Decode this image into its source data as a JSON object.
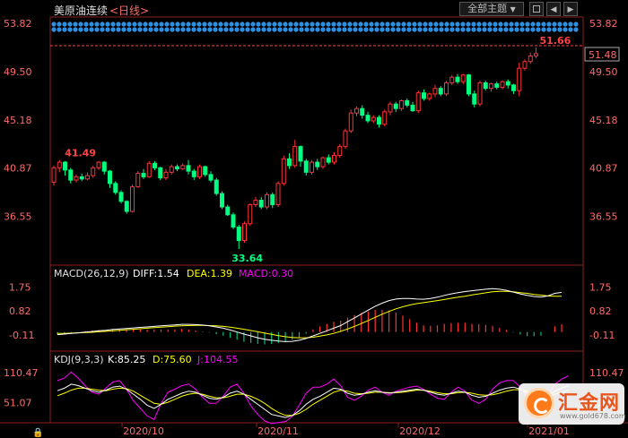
{
  "header": {
    "title": "美原油连续",
    "period": "<日线>",
    "theme_button": "全部主题",
    "theme_arrow": "▼"
  },
  "price_panel": {
    "last_price": "51.48",
    "annotations": {
      "high": "41.49",
      "low": "33.64",
      "peak": "51.66"
    }
  },
  "macd": {
    "label": "MACD(26,12,9)",
    "diff_label": "DIFF:1.54",
    "dea_label": "DEA:1.39",
    "macd_label": "MACD:0.30",
    "colors": {
      "diff": "#ffffff",
      "dea": "#ffff00",
      "macd": "#ff00ff",
      "up": "#ff3232",
      "down": "#00c080"
    }
  },
  "kdj": {
    "label": "KDJ(9,3,3)",
    "k_label": "K:85.25",
    "d_label": "D:75.60",
    "j_label": "J:104.55"
  },
  "watermark": {
    "name": "汇金网",
    "url": "www.gold678.com"
  },
  "chart_data": [
    {
      "type": "candlestick",
      "title": "美原油连续 <日线>",
      "ylim": [
        33.0,
        53.82
      ],
      "y_ticks": [
        "53.82",
        "49.50",
        "45.18",
        "40.87",
        "36.55"
      ],
      "x_ticks": [
        "2020/10",
        "2020/11",
        "2020/12",
        "2021/01"
      ],
      "colors": {
        "up": "#ff3232",
        "down": "#00ff80"
      },
      "candles": [
        [
          39.6,
          40.9,
          39.3,
          41.1
        ],
        [
          40.9,
          41.4,
          40.5,
          41.6
        ],
        [
          41.4,
          40.7,
          40.2,
          41.5
        ],
        [
          40.7,
          39.8,
          39.5,
          40.9
        ],
        [
          39.8,
          40.1,
          39.6,
          40.3
        ],
        [
          40.1,
          39.9,
          39.7,
          40.4
        ],
        [
          39.9,
          40.2,
          39.8,
          40.5
        ],
        [
          40.2,
          40.9,
          40.0,
          41.1
        ],
        [
          40.9,
          41.4,
          40.7,
          41.5
        ],
        [
          41.4,
          40.6,
          40.3,
          41.5
        ],
        [
          40.6,
          39.5,
          39.1,
          40.7
        ],
        [
          39.5,
          38.7,
          38.5,
          39.7
        ],
        [
          38.7,
          37.9,
          37.7,
          38.9
        ],
        [
          37.9,
          37.0,
          36.8,
          38.0
        ],
        [
          37.0,
          39.2,
          36.9,
          39.4
        ],
        [
          39.2,
          40.4,
          39.1,
          40.6
        ],
        [
          40.4,
          40.1,
          39.9,
          40.8
        ],
        [
          40.1,
          41.3,
          40.0,
          41.5
        ],
        [
          41.3,
          40.9,
          40.7,
          41.5
        ],
        [
          40.9,
          40.0,
          39.8,
          41.0
        ],
        [
          40.0,
          40.5,
          39.8,
          40.8
        ],
        [
          40.5,
          41.0,
          40.3,
          41.2
        ],
        [
          41.0,
          40.8,
          40.6,
          41.2
        ],
        [
          40.8,
          41.1,
          40.7,
          41.3
        ],
        [
          41.1,
          40.6,
          40.3,
          41.6
        ],
        [
          40.6,
          40.1,
          39.8,
          40.8
        ],
        [
          40.1,
          41.0,
          39.9,
          41.2
        ],
        [
          41.0,
          40.3,
          40.1,
          41.1
        ],
        [
          40.3,
          39.8,
          39.6,
          40.6
        ],
        [
          39.8,
          38.6,
          38.4,
          40.0
        ],
        [
          38.6,
          37.4,
          37.2,
          38.8
        ],
        [
          37.4,
          36.7,
          36.6,
          37.6
        ],
        [
          36.7,
          35.6,
          35.4,
          36.9
        ],
        [
          35.6,
          34.4,
          33.64,
          35.8
        ],
        [
          34.4,
          35.9,
          34.2,
          36.1
        ],
        [
          35.9,
          37.6,
          35.7,
          37.7
        ],
        [
          37.6,
          38.0,
          37.4,
          38.3
        ],
        [
          38.0,
          37.4,
          37.2,
          38.3
        ],
        [
          37.4,
          38.5,
          37.2,
          38.7
        ],
        [
          38.5,
          37.6,
          37.3,
          38.7
        ],
        [
          37.6,
          39.5,
          37.4,
          39.7
        ],
        [
          39.5,
          41.7,
          39.3,
          42.0
        ],
        [
          41.7,
          41.1,
          40.8,
          42.2
        ],
        [
          41.1,
          42.8,
          40.9,
          43.4
        ],
        [
          42.8,
          41.5,
          41.0,
          42.9
        ],
        [
          41.5,
          40.5,
          40.2,
          41.7
        ],
        [
          40.5,
          41.4,
          40.3,
          41.6
        ],
        [
          41.4,
          41.0,
          40.7,
          41.7
        ],
        [
          41.0,
          41.8,
          40.8,
          41.9
        ],
        [
          41.8,
          41.4,
          41.2,
          42.1
        ],
        [
          41.4,
          42.0,
          41.2,
          42.3
        ],
        [
          42.0,
          42.8,
          41.8,
          43.0
        ],
        [
          42.8,
          44.2,
          42.6,
          44.4
        ],
        [
          44.2,
          45.8,
          44.0,
          46.1
        ],
        [
          45.8,
          46.2,
          45.5,
          46.4
        ],
        [
          46.2,
          45.6,
          45.3,
          46.5
        ],
        [
          45.6,
          45.1,
          44.9,
          45.9
        ],
        [
          45.1,
          45.4,
          44.9,
          45.6
        ],
        [
          45.4,
          44.8,
          44.5,
          45.6
        ],
        [
          44.8,
          45.9,
          44.6,
          46.1
        ],
        [
          45.9,
          46.6,
          45.6,
          46.8
        ],
        [
          46.6,
          46.2,
          45.9,
          46.8
        ],
        [
          46.2,
          46.9,
          46.0,
          47.0
        ],
        [
          46.9,
          46.5,
          46.3,
          47.1
        ],
        [
          46.5,
          46.0,
          45.9,
          46.8
        ],
        [
          46.0,
          47.6,
          45.8,
          47.8
        ],
        [
          47.6,
          47.1,
          46.9,
          47.9
        ],
        [
          47.1,
          47.5,
          46.9,
          47.6
        ],
        [
          47.5,
          48.0,
          47.2,
          48.3
        ],
        [
          48.0,
          47.5,
          47.3,
          48.2
        ],
        [
          47.5,
          48.5,
          47.3,
          48.7
        ],
        [
          48.5,
          49.0,
          48.3,
          49.2
        ],
        [
          49.0,
          48.6,
          48.4,
          49.3
        ],
        [
          48.6,
          49.2,
          48.4,
          49.3
        ],
        [
          49.2,
          47.5,
          47.3,
          49.3
        ],
        [
          47.5,
          46.6,
          46.3,
          47.8
        ],
        [
          46.6,
          48.5,
          46.4,
          48.7
        ],
        [
          48.5,
          48.0,
          47.8,
          48.7
        ],
        [
          48.0,
          48.4,
          47.7,
          48.5
        ],
        [
          48.4,
          48.1,
          47.9,
          48.6
        ],
        [
          48.1,
          48.6,
          47.9,
          48.7
        ],
        [
          48.6,
          48.3,
          48.0,
          48.8
        ],
        [
          48.3,
          47.8,
          47.5,
          48.4
        ],
        [
          47.8,
          49.8,
          47.3,
          50.3
        ],
        [
          49.8,
          50.4,
          49.6,
          50.6
        ],
        [
          50.4,
          50.9,
          50.2,
          51.2
        ],
        [
          50.9,
          51.1,
          50.7,
          51.66
        ]
      ]
    },
    {
      "type": "line+bar",
      "title": "MACD(26,12,9)",
      "ylim": [
        -0.6,
        1.9
      ],
      "y_ticks": [
        "1.75",
        "0.82",
        "-0.11"
      ],
      "diff": [
        -0.1,
        -0.08,
        -0.05,
        -0.03,
        0.0,
        0.02,
        0.05,
        0.07,
        0.1,
        0.12,
        0.14,
        0.16,
        0.18,
        0.2,
        0.22,
        0.24,
        0.26,
        0.28,
        0.3,
        0.3,
        0.29,
        0.27,
        0.24,
        0.2,
        0.15,
        0.08,
        0.0,
        -0.08,
        -0.15,
        -0.22,
        -0.28,
        -0.32,
        -0.35,
        -0.37,
        -0.36,
        -0.32,
        -0.25,
        -0.15,
        -0.05,
        0.05,
        0.15,
        0.25,
        0.4,
        0.55,
        0.7,
        0.85,
        1.0,
        1.12,
        1.22,
        1.28,
        1.3,
        1.3,
        1.28,
        1.27,
        1.3,
        1.35,
        1.42,
        1.48,
        1.53,
        1.57,
        1.6,
        1.63,
        1.66,
        1.68,
        1.66,
        1.62,
        1.55,
        1.48,
        1.42,
        1.38,
        1.36,
        1.4,
        1.5,
        1.54
      ],
      "dea": [
        -0.05,
        -0.05,
        -0.04,
        -0.03,
        -0.02,
        -0.01,
        0.01,
        0.03,
        0.05,
        0.07,
        0.09,
        0.11,
        0.13,
        0.15,
        0.17,
        0.19,
        0.21,
        0.23,
        0.24,
        0.25,
        0.26,
        0.26,
        0.25,
        0.24,
        0.22,
        0.19,
        0.15,
        0.11,
        0.06,
        0.01,
        -0.04,
        -0.09,
        -0.14,
        -0.18,
        -0.21,
        -0.22,
        -0.22,
        -0.2,
        -0.16,
        -0.11,
        -0.05,
        0.03,
        0.12,
        0.22,
        0.33,
        0.45,
        0.57,
        0.69,
        0.8,
        0.9,
        0.98,
        1.05,
        1.1,
        1.14,
        1.18,
        1.22,
        1.26,
        1.31,
        1.35,
        1.39,
        1.44,
        1.48,
        1.52,
        1.56,
        1.58,
        1.58,
        1.56,
        1.53,
        1.5,
        1.46,
        1.43,
        1.4,
        1.39,
        1.39
      ]
    },
    {
      "type": "line",
      "title": "KDJ(9,3,3)",
      "ylim": [
        15,
        125
      ],
      "y_ticks": [
        "110.47",
        "51.07"
      ],
      "k": [
        75,
        80,
        88,
        85,
        80,
        75,
        72,
        76,
        82,
        84,
        78,
        68,
        58,
        46,
        40,
        48,
        58,
        64,
        70,
        74,
        72,
        66,
        60,
        58,
        62,
        70,
        74,
        68,
        58,
        48,
        38,
        28,
        25,
        22,
        26,
        35,
        48,
        58,
        64,
        72,
        80,
        78,
        70,
        66,
        68,
        72,
        75,
        72,
        70,
        72,
        74,
        76,
        78,
        76,
        72,
        68,
        66,
        70,
        74,
        72,
        66,
        62,
        64,
        70,
        76,
        80,
        82,
        78,
        70,
        62,
        60,
        66,
        74,
        80,
        85.25
      ],
      "d": [
        65,
        70,
        76,
        80,
        80,
        78,
        76,
        75,
        78,
        80,
        79,
        74,
        66,
        58,
        50,
        48,
        52,
        58,
        64,
        68,
        70,
        68,
        64,
        61,
        61,
        64,
        68,
        68,
        64,
        58,
        50,
        40,
        32,
        26,
        26,
        30,
        38,
        48,
        56,
        64,
        72,
        76,
        74,
        70,
        69,
        70,
        72,
        72,
        71,
        71,
        72,
        74,
        76,
        76,
        74,
        71,
        69,
        69,
        71,
        72,
        70,
        67,
        66,
        67,
        70,
        74,
        77,
        77,
        74,
        69,
        65,
        65,
        68,
        72,
        75.6
      ],
      "j": [
        95,
        100,
        112,
        100,
        85,
        72,
        68,
        80,
        92,
        95,
        78,
        55,
        40,
        25,
        18,
        50,
        72,
        78,
        85,
        88,
        78,
        62,
        50,
        50,
        64,
        82,
        88,
        70,
        45,
        28,
        15,
        10,
        12,
        14,
        24,
        46,
        70,
        82,
        82,
        88,
        98,
        85,
        62,
        56,
        64,
        76,
        82,
        72,
        66,
        74,
        78,
        82,
        84,
        78,
        68,
        60,
        58,
        72,
        82,
        74,
        56,
        50,
        58,
        78,
        90,
        95,
        95,
        82,
        62,
        46,
        46,
        66,
        88,
        98,
        104.55
      ]
    }
  ]
}
